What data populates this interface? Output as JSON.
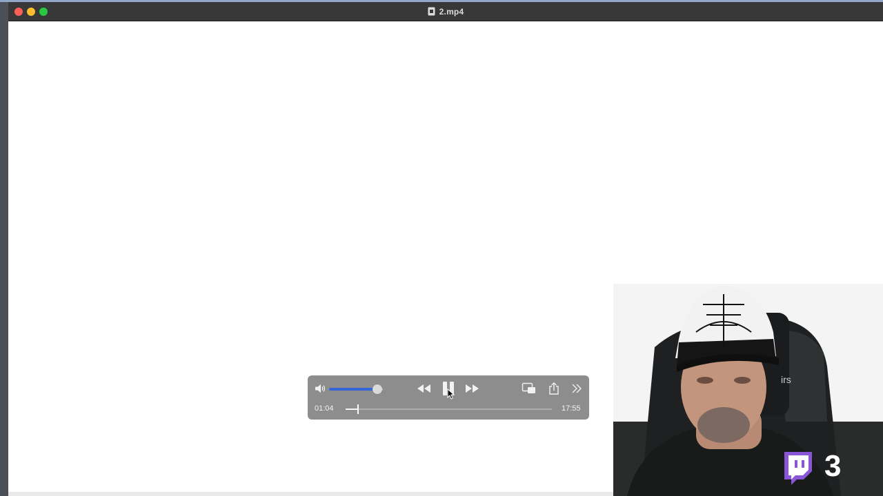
{
  "window": {
    "title": "2.mp4"
  },
  "player": {
    "elapsed": "01:04",
    "total": "17:55",
    "progress": 0.061,
    "volume": 0.9,
    "accent_color": "#2f63d7"
  },
  "icons": {
    "volume": "speaker-icon",
    "rewind": "rewind-icon",
    "pause": "pause-icon",
    "forward": "fast-forward-icon",
    "pip": "picture-in-picture-icon",
    "share": "share-icon",
    "more": "chevron-double-right-icon"
  },
  "webcam": {
    "chair_text": "irs",
    "badge_number": "3"
  }
}
